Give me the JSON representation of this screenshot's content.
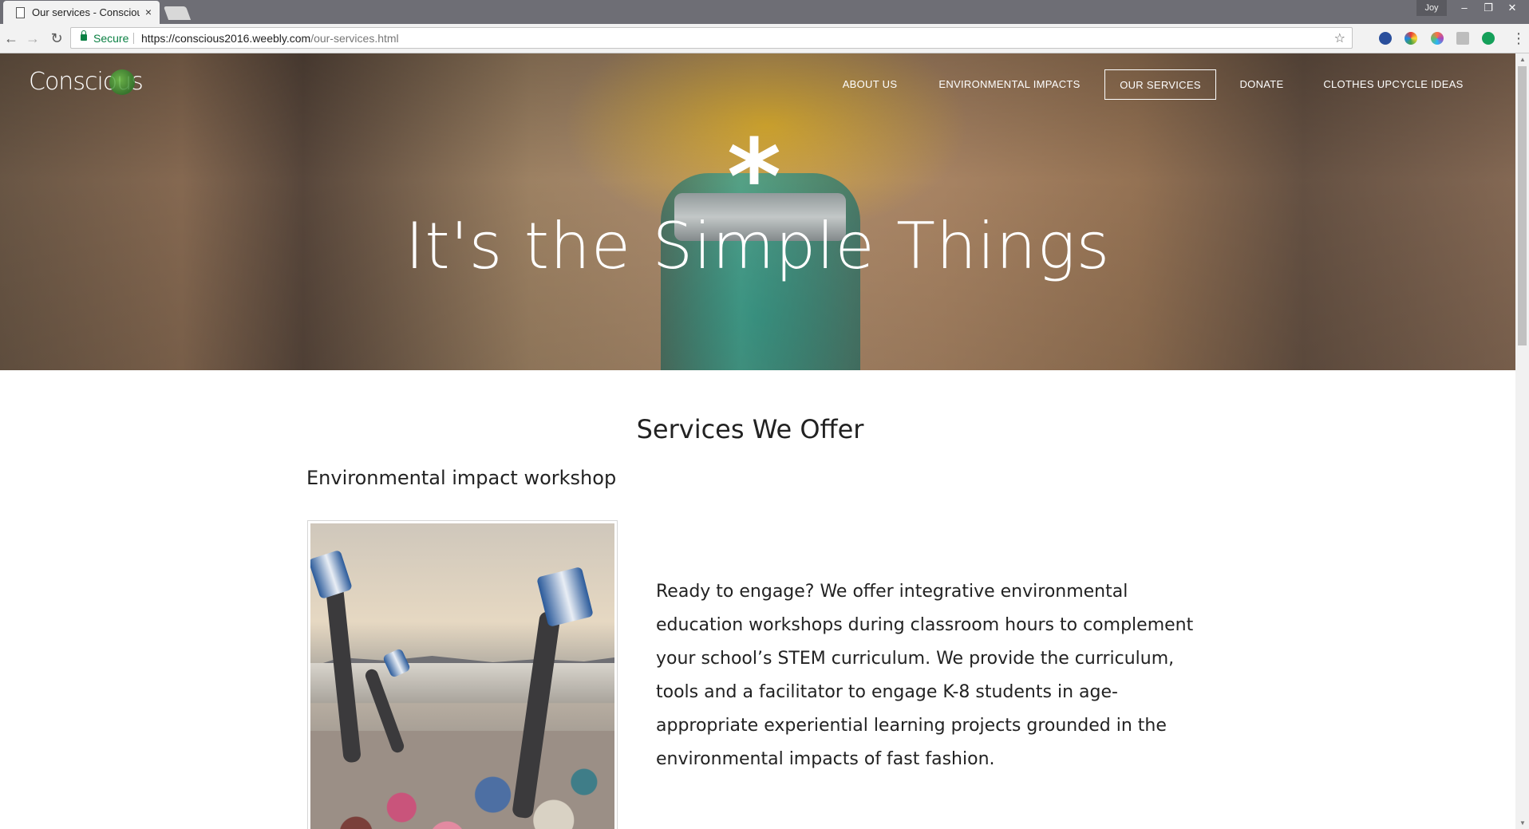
{
  "browser": {
    "tab_title": "Our services - Conscious",
    "tab_close": "×",
    "profile_name": "Joy",
    "secure_label": "Secure",
    "url_host": "https://conscious2016.weebly.com",
    "url_path": "/our-services.html",
    "window_controls": [
      "–",
      "❐",
      "✕"
    ],
    "icons": [
      "back-icon",
      "forward-icon",
      "reload-icon",
      "lock-icon",
      "star-icon",
      "menu-icon"
    ]
  },
  "site": {
    "logo": "Conscious",
    "nav": [
      {
        "label": "ABOUT US",
        "active": false
      },
      {
        "label": "ENVIRONMENTAL IMPACTS",
        "active": false
      },
      {
        "label": "OUR SERVICES",
        "active": true
      },
      {
        "label": "DONATE",
        "active": false
      },
      {
        "label": "CLOTHES UPCYCLE IDEAS",
        "active": false
      }
    ],
    "hero_symbol": "*",
    "hero_title": "It's the Simple Things"
  },
  "content": {
    "section_title": "Services We Offer",
    "sub_title": "Environmental impact workshop",
    "body": "Ready to engage? We offer integrative environmental education workshops during classroom hours to complement your school’s STEM curriculum. We provide the curriculum, tools and a facilitator to engage K-8 students in age-appropriate experiential learning projects grounded in the environmental impacts of fast fashion."
  },
  "colors": {
    "secure_green": "#0b8043",
    "tabbar": "#6e6e75",
    "text": "#222222"
  }
}
